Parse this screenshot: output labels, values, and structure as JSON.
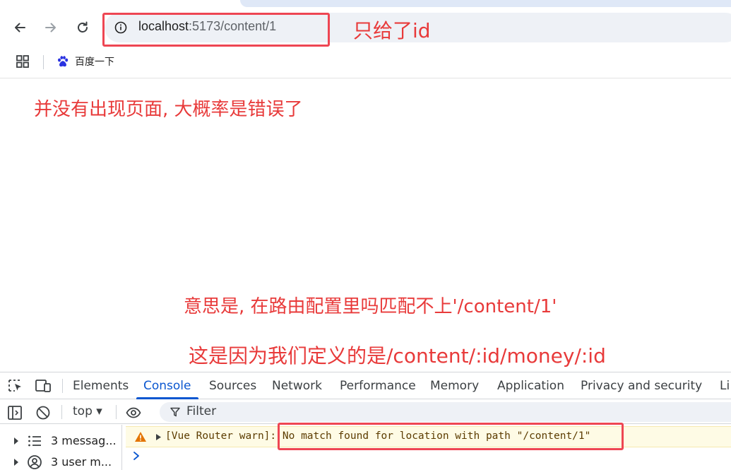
{
  "browser": {
    "url_host": "localhost",
    "url_path": ":5173/content/1",
    "bookmark_label": "百度一下"
  },
  "annotations": {
    "only_id": "只给了id",
    "no_page": "并没有出现页面, 大概率是错误了",
    "meaning": "意思是, 在路由配置里吗匹配不上'/content/1'",
    "reason": "这是因为我们定义的是/content/:id/money/:id"
  },
  "devtools": {
    "tabs": [
      "Elements",
      "Console",
      "Sources",
      "Network",
      "Performance",
      "Memory",
      "Application",
      "Privacy and security",
      "Li"
    ],
    "active_tab": "Console",
    "context": "top ▾",
    "filter_placeholder": "Filter",
    "sidebar": [
      {
        "label": "3 messag..."
      },
      {
        "label": "3 user m..."
      }
    ],
    "warning": {
      "prefix": "[Vue Router warn]: ",
      "message": "No match found for location with path \"/content/1\""
    }
  },
  "colors": {
    "annotation": "#e83a3a",
    "highlight_box": "#ee4653",
    "active_tab": "#0b57d0",
    "warning_bg": "#fefbe5"
  }
}
